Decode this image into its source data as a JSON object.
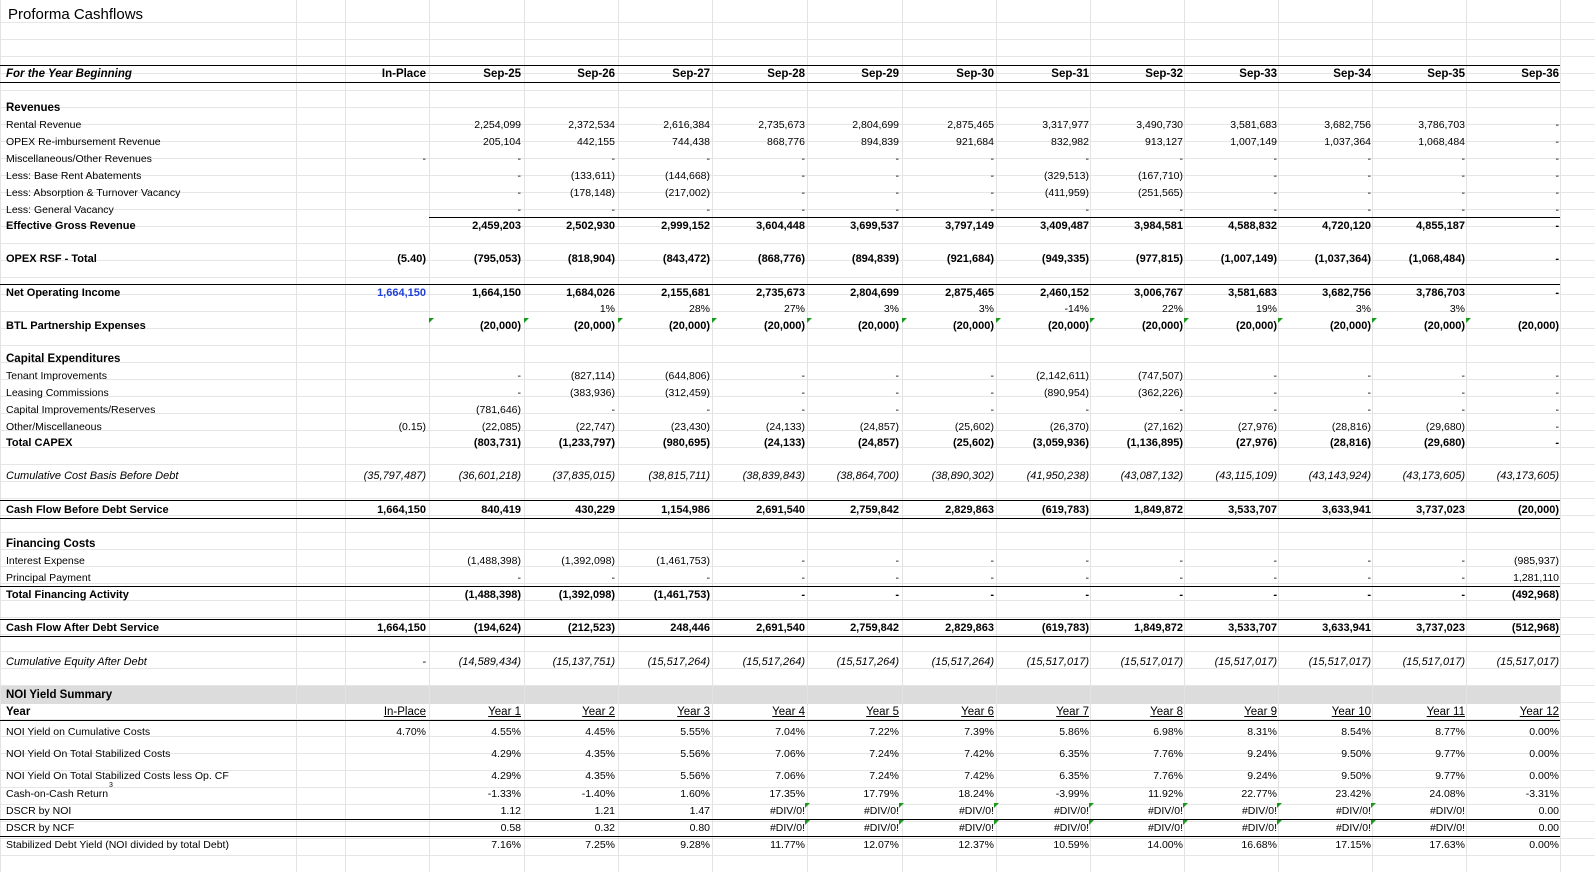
{
  "title": "Proforma Cashflows",
  "header": {
    "label": "For the Year Beginning",
    "cols": [
      "In-Place",
      "Sep-25",
      "Sep-26",
      "Sep-27",
      "Sep-28",
      "Sep-29",
      "Sep-30",
      "Sep-31",
      "Sep-32",
      "Sep-33",
      "Sep-34",
      "Sep-35",
      "Sep-36"
    ]
  },
  "revenues": {
    "section": "Revenues",
    "rows": [
      {
        "label": "Rental Revenue",
        "values": [
          "",
          "2,254,099",
          "2,372,534",
          "2,616,384",
          "2,735,673",
          "2,804,699",
          "2,875,465",
          "3,317,977",
          "3,490,730",
          "3,581,683",
          "3,682,756",
          "3,786,703",
          "-"
        ]
      },
      {
        "label": "OPEX Re-imbursement Revenue",
        "values": [
          "",
          "205,104",
          "442,155",
          "744,438",
          "868,776",
          "894,839",
          "921,684",
          "832,982",
          "913,127",
          "1,007,149",
          "1,037,364",
          "1,068,484",
          "-"
        ]
      },
      {
        "label": "Miscellaneous/Other Revenues",
        "values": [
          "-",
          "-",
          "-",
          "-",
          "-",
          "-",
          "-",
          "-",
          "-",
          "-",
          "-",
          "-",
          "-"
        ]
      },
      {
        "label": "Less: Base Rent Abatements",
        "values": [
          "",
          "-",
          "(133,611)",
          "(144,668)",
          "-",
          "-",
          "-",
          "(329,513)",
          "(167,710)",
          "-",
          "-",
          "-",
          "-"
        ]
      },
      {
        "label": "Less: Absorption & Turnover Vacancy",
        "values": [
          "",
          "-",
          "(178,148)",
          "(217,002)",
          "-",
          "-",
          "-",
          "(411,959)",
          "(251,565)",
          "-",
          "-",
          "-",
          "-"
        ]
      },
      {
        "label": "Less: General Vacancy",
        "values": [
          "",
          "-",
          "-",
          "-",
          "-",
          "-",
          "-",
          "-",
          "-",
          "-",
          "-",
          "-",
          "-"
        ]
      }
    ],
    "total": {
      "label": "Effective Gross Revenue",
      "values": [
        "",
        "2,459,203",
        "2,502,930",
        "2,999,152",
        "3,604,448",
        "3,699,537",
        "3,797,149",
        "3,409,487",
        "3,984,581",
        "4,588,832",
        "4,720,120",
        "4,855,187",
        "-"
      ]
    }
  },
  "opex": {
    "label": "OPEX RSF - Total",
    "values": [
      "(5.40)",
      "(795,053)",
      "(818,904)",
      "(843,472)",
      "(868,776)",
      "(894,839)",
      "(921,684)",
      "(949,335)",
      "(977,815)",
      "(1,007,149)",
      "(1,037,364)",
      "(1,068,484)",
      "-"
    ]
  },
  "noi": {
    "label": "Net Operating Income",
    "values": [
      "1,664,150",
      "1,664,150",
      "1,684,026",
      "2,155,681",
      "2,735,673",
      "2,804,699",
      "2,875,465",
      "2,460,152",
      "3,006,767",
      "3,581,683",
      "3,682,756",
      "3,786,703",
      "-"
    ]
  },
  "noi_growth": {
    "values": [
      "",
      "",
      "1%",
      "28%",
      "27%",
      "3%",
      "3%",
      "-14%",
      "22%",
      "19%",
      "3%",
      "3%",
      ""
    ]
  },
  "btl": {
    "label": "BTL Partnership Expenses",
    "values": [
      "",
      "(20,000)",
      "(20,000)",
      "(20,000)",
      "(20,000)",
      "(20,000)",
      "(20,000)",
      "(20,000)",
      "(20,000)",
      "(20,000)",
      "(20,000)",
      "(20,000)",
      "(20,000)"
    ]
  },
  "capex": {
    "section": "Capital Expenditures",
    "rows": [
      {
        "label": "Tenant Improvements",
        "values": [
          "",
          "-",
          "(827,114)",
          "(644,806)",
          "-",
          "-",
          "-",
          "(2,142,611)",
          "(747,507)",
          "-",
          "-",
          "-",
          "-"
        ]
      },
      {
        "label": "Leasing Commissions",
        "values": [
          "",
          "-",
          "(383,936)",
          "(312,459)",
          "-",
          "-",
          "-",
          "(890,954)",
          "(362,226)",
          "-",
          "-",
          "-",
          "-"
        ]
      },
      {
        "label": "Capital Improvements/Reserves",
        "values": [
          "",
          "(781,646)",
          "-",
          "-",
          "-",
          "-",
          "-",
          "-",
          "-",
          "-",
          "-",
          "-",
          "-"
        ]
      },
      {
        "label": "Other/Miscellaneous",
        "values": [
          "(0.15)",
          "(22,085)",
          "(22,747)",
          "(23,430)",
          "(24,133)",
          "(24,857)",
          "(25,602)",
          "(26,370)",
          "(27,162)",
          "(27,976)",
          "(28,816)",
          "(29,680)",
          "-"
        ]
      }
    ],
    "total": {
      "label": "Total CAPEX",
      "values": [
        "",
        "(803,731)",
        "(1,233,797)",
        "(980,695)",
        "(24,133)",
        "(24,857)",
        "(25,602)",
        "(3,059,936)",
        "(1,136,895)",
        "(27,976)",
        "(28,816)",
        "(29,680)",
        "-"
      ]
    }
  },
  "cum_cost": {
    "label": "Cumulative Cost Basis Before Debt",
    "values": [
      "(35,797,487)",
      "(36,601,218)",
      "(37,835,015)",
      "(38,815,711)",
      "(38,839,843)",
      "(38,864,700)",
      "(38,890,302)",
      "(41,950,238)",
      "(43,087,132)",
      "(43,115,109)",
      "(43,143,924)",
      "(43,173,605)",
      "(43,173,605)"
    ]
  },
  "cfbds": {
    "label": "Cash Flow Before Debt Service",
    "values": [
      "1,664,150",
      "840,419",
      "430,229",
      "1,154,986",
      "2,691,540",
      "2,759,842",
      "2,829,863",
      "(619,783)",
      "1,849,872",
      "3,533,707",
      "3,633,941",
      "3,737,023",
      "(20,000)"
    ]
  },
  "financing": {
    "section": "Financing Costs",
    "rows": [
      {
        "label": "Interest Expense",
        "values": [
          "",
          "(1,488,398)",
          "(1,392,098)",
          "(1,461,753)",
          "-",
          "-",
          "-",
          "-",
          "-",
          "-",
          "-",
          "-",
          "(985,937)"
        ]
      },
      {
        "label": "Principal Payment",
        "values": [
          "",
          "-",
          "-",
          "-",
          "-",
          "-",
          "-",
          "-",
          "-",
          "-",
          "-",
          "-",
          "1,281,110"
        ]
      }
    ],
    "total": {
      "label": "Total Financing Activity",
      "values": [
        "",
        "(1,488,398)",
        "(1,392,098)",
        "(1,461,753)",
        "-",
        "-",
        "-",
        "-",
        "-",
        "-",
        "-",
        "-",
        "(492,968)"
      ]
    }
  },
  "cfads": {
    "label": "Cash Flow After Debt Service",
    "values": [
      "1,664,150",
      "(194,624)",
      "(212,523)",
      "248,446",
      "2,691,540",
      "2,759,842",
      "2,829,863",
      "(619,783)",
      "1,849,872",
      "3,533,707",
      "3,633,941",
      "3,737,023",
      "(512,968)"
    ]
  },
  "cum_equity": {
    "label": "Cumulative Equity After Debt",
    "values": [
      "-",
      "(14,589,434)",
      "(15,137,751)",
      "(15,517,264)",
      "(15,517,264)",
      "(15,517,264)",
      "(15,517,264)",
      "(15,517,017)",
      "(15,517,017)",
      "(15,517,017)",
      "(15,517,017)",
      "(15,517,017)",
      "(15,517,017)"
    ]
  },
  "yield_summary": {
    "section": "NOI Yield Summary",
    "year_label": "Year",
    "year_cols": [
      "In-Place",
      "Year  1",
      "Year  2",
      "Year  3",
      "Year  4",
      "Year  5",
      "Year  6",
      "Year  7",
      "Year  8",
      "Year  9",
      "Year  10",
      "Year  11",
      "Year  12"
    ],
    "rows": [
      {
        "label": "NOI Yield on Cumulative Costs",
        "values": [
          "4.70%",
          "4.55%",
          "4.45%",
          "5.55%",
          "7.04%",
          "7.22%",
          "7.39%",
          "5.86%",
          "6.98%",
          "8.31%",
          "8.54%",
          "8.77%",
          "0.00%"
        ]
      },
      {
        "label": "NOI Yield On Total Stabilized Costs",
        "values": [
          "",
          "4.29%",
          "4.35%",
          "5.56%",
          "7.06%",
          "7.24%",
          "7.42%",
          "6.35%",
          "7.76%",
          "9.24%",
          "9.50%",
          "9.77%",
          "0.00%"
        ]
      },
      {
        "label": "NOI Yield On Total Stabilized Costs less Op. CF",
        "values": [
          "",
          "4.29%",
          "4.35%",
          "5.56%",
          "7.06%",
          "7.24%",
          "7.42%",
          "6.35%",
          "7.76%",
          "9.24%",
          "9.50%",
          "9.77%",
          "0.00%"
        ]
      },
      {
        "label": "Cash-on-Cash Return",
        "sup": "3",
        "values": [
          "",
          "-1.33%",
          "-1.40%",
          "1.60%",
          "17.35%",
          "17.79%",
          "18.24%",
          "-3.99%",
          "11.92%",
          "22.77%",
          "23.42%",
          "24.08%",
          "-3.31%"
        ]
      },
      {
        "label": "DSCR by NOI",
        "values": [
          "",
          "1.12",
          "1.21",
          "1.47",
          "#DIV/0!",
          "#DIV/0!",
          "#DIV/0!",
          "#DIV/0!",
          "#DIV/0!",
          "#DIV/0!",
          "#DIV/0!",
          "#DIV/0!",
          "0.00"
        ]
      },
      {
        "label": "DSCR by NCF",
        "values": [
          "",
          "0.58",
          "0.32",
          "0.80",
          "#DIV/0!",
          "#DIV/0!",
          "#DIV/0!",
          "#DIV/0!",
          "#DIV/0!",
          "#DIV/0!",
          "#DIV/0!",
          "#DIV/0!",
          "0.00"
        ]
      },
      {
        "label": "Stabilized Debt Yield (NOI divided by total Debt)",
        "values": [
          "",
          "7.16%",
          "7.25%",
          "9.28%",
          "11.77%",
          "12.07%",
          "12.37%",
          "10.59%",
          "14.00%",
          "16.68%",
          "17.15%",
          "17.63%",
          "0.00%"
        ]
      }
    ]
  }
}
